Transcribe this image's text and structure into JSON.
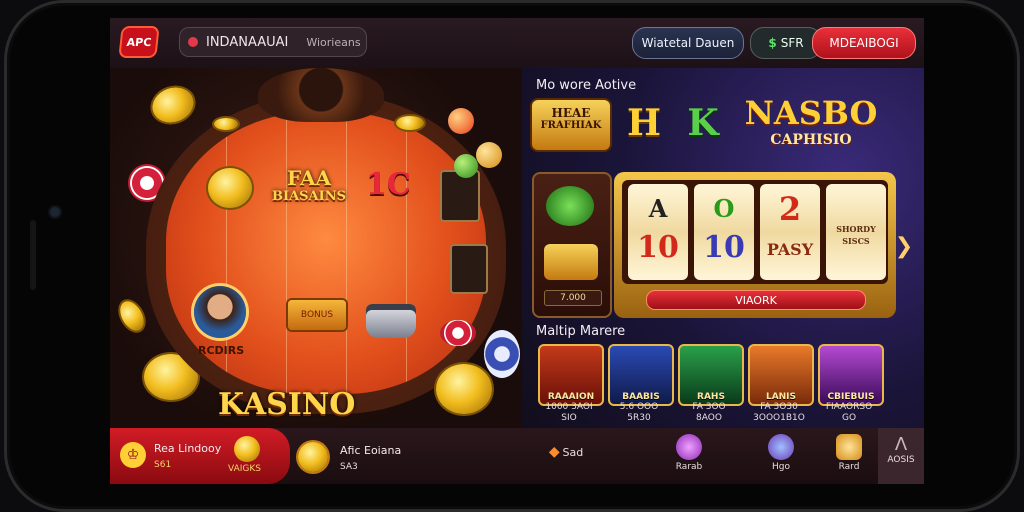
{
  "header": {
    "logo_text": "APC",
    "username": "INDANAAUAI",
    "user_status": "Wiorieans",
    "button_dark": "Wiatetal Dauen",
    "button_green_icon": "$",
    "button_green_label": "SFR",
    "button_red": "MDEAIBOGI"
  },
  "table": {
    "sign_top": "FAA\nBIASAINS",
    "sign_top_l1": "FAA",
    "sign_top_l2": "BIASAINS",
    "sign_num": "1C",
    "avatar_label": "RCDIRS",
    "gift_label": "BONUS",
    "title": "KASINO"
  },
  "right": {
    "section1_title": "Mo wore Aotive",
    "badge1_l1": "HEAE",
    "badge1_l2": "FRAFHIAK",
    "badge2": "H",
    "badge3": "K",
    "badge4_l1": "NASBO",
    "badge4_l2": "CAPHISIO",
    "side_label": "7.000",
    "reels": [
      {
        "top": "A",
        "bottom": "10"
      },
      {
        "top": "O",
        "bottom": "10"
      },
      {
        "top": "2",
        "bottom": "PASY"
      },
      {
        "top": "SHORDY",
        "bottom": "SISCS"
      }
    ],
    "slot_button": "VIAORK",
    "section2_title": "Maltip Marere",
    "games": [
      {
        "label": "RAAAION",
        "meta1": "1000 3AOI",
        "meta2": "SIO"
      },
      {
        "label": "BAABIS",
        "meta1": "5.6 OOO",
        "meta2": "5R30"
      },
      {
        "label": "RAHS",
        "meta1": "FA 3OO",
        "meta2": "8AOO"
      },
      {
        "label": "LANIS",
        "meta1": "FA 3O30",
        "meta2": "3OOO1B1O"
      },
      {
        "label": "CBIEBUIS",
        "meta1": "FIAAORSO",
        "meta2": "GO"
      }
    ]
  },
  "bottombar": {
    "left_title": "Rea Lindooy",
    "left_sub1": "S61",
    "left_sub2": "VAIGKS",
    "mid_title": "Afic Eoiana",
    "mid_sub": "SA3",
    "nav": [
      {
        "label": "Sad"
      },
      {
        "label": "Rarab"
      },
      {
        "label": "Hgo"
      },
      {
        "label": "Rard"
      },
      {
        "label": "AOSIS"
      }
    ]
  },
  "colors": {
    "accent_red": "#d21c26",
    "gold": "#f2bd1e",
    "felt": "#e2501c"
  }
}
